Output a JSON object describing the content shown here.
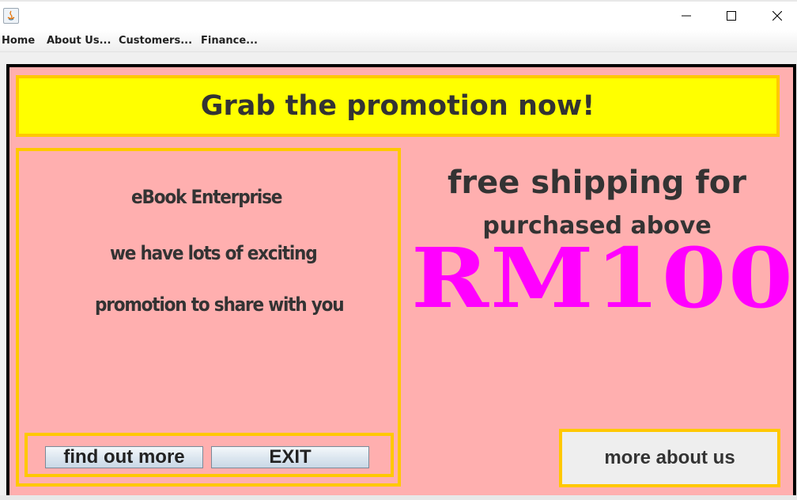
{
  "window": {
    "controls": {
      "minimize_icon": "minimize-icon",
      "maximize_icon": "maximize-icon",
      "close_icon": "close-icon"
    }
  },
  "menubar": {
    "items": [
      {
        "label": "Home"
      },
      {
        "label": "About Us..."
      },
      {
        "label": "Customers..."
      },
      {
        "label": "Finance..."
      }
    ]
  },
  "banner": {
    "text": "Grab the promotion now!"
  },
  "left_panel": {
    "line1": "eBook Enterprise",
    "line2": "we have lots of exciting",
    "line3": "promotion to share with you"
  },
  "buttons": {
    "find_out_more": "find out more",
    "exit": "EXIT",
    "more_about_us": "more about us"
  },
  "shipping": {
    "line1": "free shipping for",
    "line2": "purchased above",
    "amount": "RM100"
  },
  "colors": {
    "background": "#ffafaf",
    "banner": "#ffff00",
    "border_accent": "#ffc800",
    "amount_text": "#ff00ff",
    "text": "#333333"
  }
}
